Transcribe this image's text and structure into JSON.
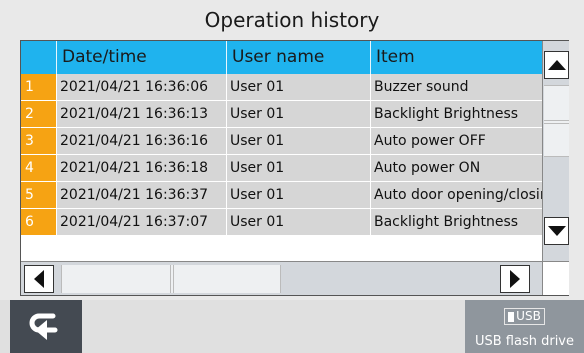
{
  "title": "Operation history",
  "table": {
    "headers": {
      "num": "",
      "date": "Date/time",
      "user": "User name",
      "item": "Item"
    },
    "rows": [
      {
        "num": "1",
        "date": "2021/04/21 16:36:06",
        "user": "User 01",
        "item": "Buzzer sound"
      },
      {
        "num": "2",
        "date": "2021/04/21 16:36:13",
        "user": "User 01",
        "item": "Backlight Brightness"
      },
      {
        "num": "3",
        "date": "2021/04/21 16:36:16",
        "user": "User 01",
        "item": "Auto power OFF"
      },
      {
        "num": "4",
        "date": "2021/04/21 16:36:18",
        "user": "User 01",
        "item": "Auto power ON"
      },
      {
        "num": "5",
        "date": "2021/04/21 16:36:37",
        "user": "User 01",
        "item": "Auto door opening/closing"
      },
      {
        "num": "6",
        "date": "2021/04/21 16:37:07",
        "user": "User 01",
        "item": "Backlight Brightness"
      }
    ]
  },
  "footer": {
    "usb_badge": "USB",
    "usb_label": "USB flash drive"
  },
  "colors": {
    "header": "#1fb3ee",
    "row_number": "#f6a313",
    "back_button": "#444a52",
    "usb_button": "#8f969d"
  }
}
